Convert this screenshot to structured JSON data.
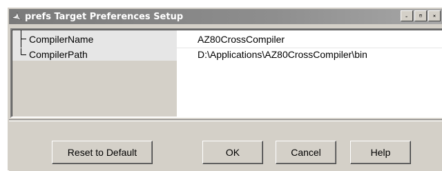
{
  "window": {
    "title": "prefs Target Preferences Setup",
    "icon": "matlab-logo-icon",
    "controls": {
      "minimize_label": "_",
      "maximize_label": "□",
      "close_label": "×"
    }
  },
  "table": {
    "rows": [
      {
        "name": "CompilerName",
        "value": "AZ80CrossCompiler"
      },
      {
        "name": "CompilerPath",
        "value": "D:\\Applications\\AZ80CrossCompiler\\bin"
      }
    ]
  },
  "buttons": {
    "reset_label": "Reset to Default",
    "ok_label": "OK",
    "cancel_label": "Cancel",
    "help_label": "Help"
  },
  "colors": {
    "title_bar": "#8e8e8e",
    "face": "#d4d0c8",
    "name_column": "#e6e6e6"
  }
}
